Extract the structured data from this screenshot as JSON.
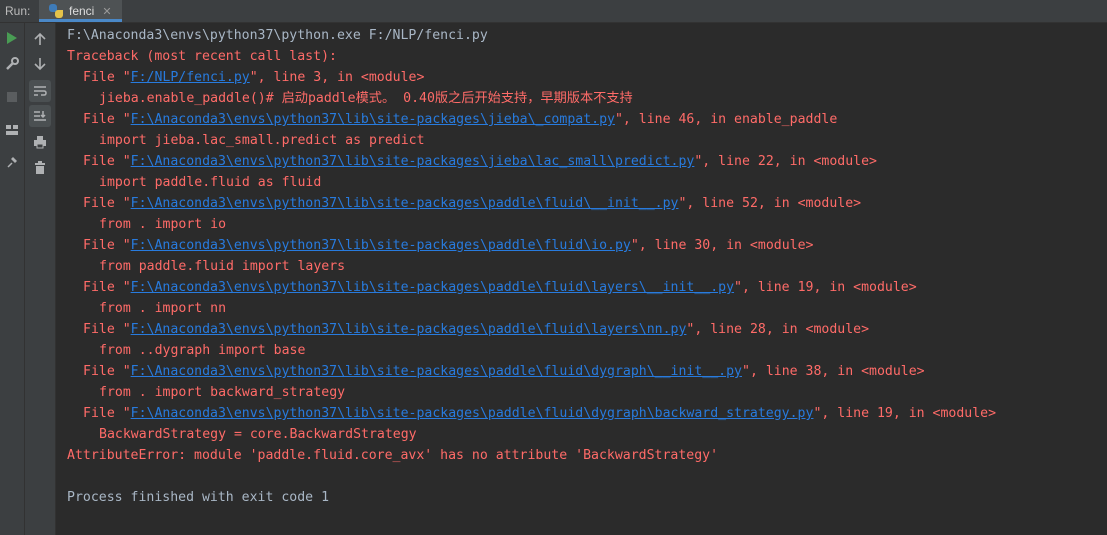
{
  "toolbar": {
    "run_label": "Run:",
    "tab_label": "fenci"
  },
  "gutter": {
    "left_icons": [
      "run-icon",
      "wrench-icon",
      "stop-icon",
      "layout-icon",
      "pin-icon"
    ],
    "right_icons": [
      "up-arrow-icon",
      "down-arrow-icon",
      "soft-wrap-icon",
      "scroll-to-end-icon",
      "print-icon",
      "trash-icon"
    ]
  },
  "console": {
    "command": "F:\\Anaconda3\\envs\\python37\\python.exe F:/NLP/fenci.py",
    "traceback_header": "Traceback (most recent call last):",
    "frames": [
      {
        "prefix": "File \"",
        "path": "F:/NLP/fenci.py",
        "suffix": "\", line 3, in <module>",
        "code": "jieba.enable_paddle()# 启动paddle模式。 0.40版之后开始支持，早期版本不支持"
      },
      {
        "prefix": "File \"",
        "path": "F:\\Anaconda3\\envs\\python37\\lib\\site-packages\\jieba\\_compat.py",
        "suffix": "\", line 46, in enable_paddle",
        "code": "import jieba.lac_small.predict as predict"
      },
      {
        "prefix": "File \"",
        "path": "F:\\Anaconda3\\envs\\python37\\lib\\site-packages\\jieba\\lac_small\\predict.py",
        "suffix": "\", line 22, in <module>",
        "code": "import paddle.fluid as fluid"
      },
      {
        "prefix": "File \"",
        "path": "F:\\Anaconda3\\envs\\python37\\lib\\site-packages\\paddle\\fluid\\__init__.py",
        "suffix": "\", line 52, in <module>",
        "code": "from . import io"
      },
      {
        "prefix": "File \"",
        "path": "F:\\Anaconda3\\envs\\python37\\lib\\site-packages\\paddle\\fluid\\io.py",
        "suffix": "\", line 30, in <module>",
        "code": "from paddle.fluid import layers"
      },
      {
        "prefix": "File \"",
        "path": "F:\\Anaconda3\\envs\\python37\\lib\\site-packages\\paddle\\fluid\\layers\\__init__.py",
        "suffix": "\", line 19, in <module>",
        "code": "from . import nn"
      },
      {
        "prefix": "File \"",
        "path": "F:\\Anaconda3\\envs\\python37\\lib\\site-packages\\paddle\\fluid\\layers\\nn.py",
        "suffix": "\", line 28, in <module>",
        "code": "from ..dygraph import base"
      },
      {
        "prefix": "File \"",
        "path": "F:\\Anaconda3\\envs\\python37\\lib\\site-packages\\paddle\\fluid\\dygraph\\__init__.py",
        "suffix": "\", line 38, in <module>",
        "code": "from . import backward_strategy"
      },
      {
        "prefix": "File \"",
        "path": "F:\\Anaconda3\\envs\\python37\\lib\\site-packages\\paddle\\fluid\\dygraph\\backward_strategy.py",
        "suffix": "\", line 19, in <module>",
        "code": "BackwardStrategy = core.BackwardStrategy"
      }
    ],
    "error": "AttributeError: module 'paddle.fluid.core_avx' has no attribute 'BackwardStrategy'",
    "exit_message": "Process finished with exit code 1"
  },
  "colors": {
    "background": "#2b2b2b",
    "normal_text": "#a9b7c6",
    "error_text": "#ff6b68",
    "link": "#287bde"
  }
}
